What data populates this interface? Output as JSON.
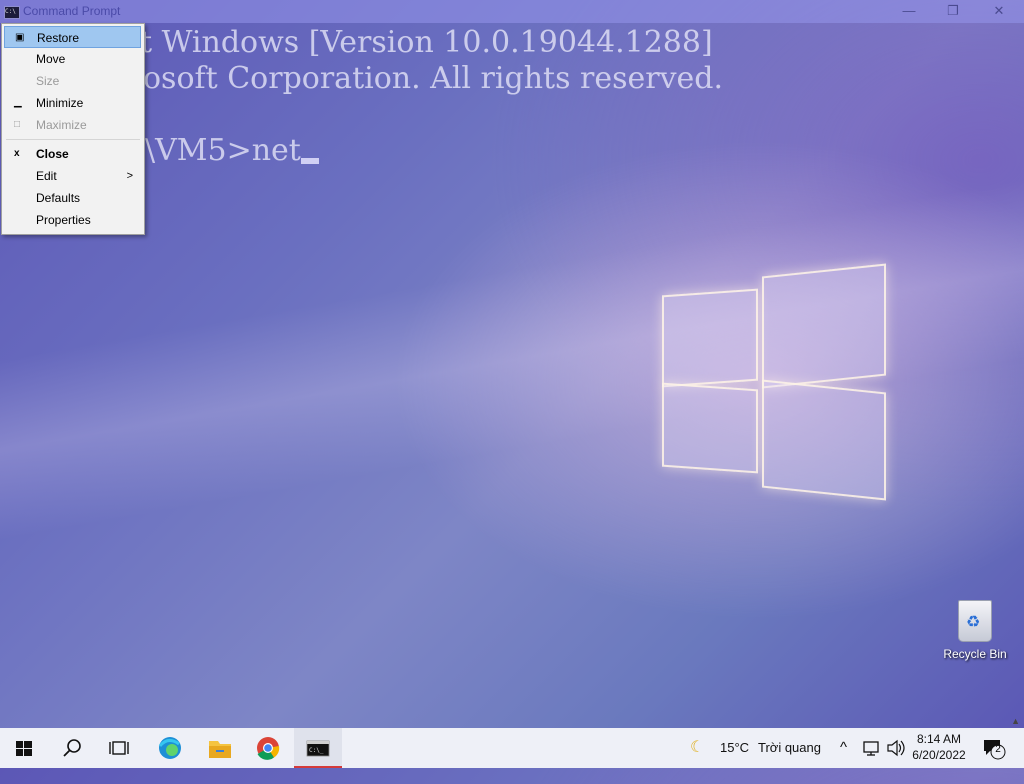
{
  "window": {
    "title": "Command Prompt",
    "icon": "console-app-icon",
    "minimize_glyph": "—",
    "maximize_glyph": "❐",
    "close_glyph": "✕"
  },
  "console": {
    "line1": "t Windows [Version 10.0.19044.1288]",
    "line2": "osoft Corporation. All rights reserved.",
    "line3": "\\VM5>net"
  },
  "system_menu": {
    "items": [
      {
        "label": "Restore",
        "glyph": "▣",
        "state": "highlighted"
      },
      {
        "label": "Move",
        "glyph": "",
        "state": "enabled"
      },
      {
        "label": "Size",
        "glyph": "",
        "state": "disabled"
      },
      {
        "label": "Minimize",
        "glyph": "▁",
        "state": "enabled"
      },
      {
        "label": "Maximize",
        "glyph": "□",
        "state": "disabled"
      },
      {
        "label": "Close",
        "glyph": "x",
        "state": "default-bold"
      },
      {
        "label": "Edit",
        "glyph": "",
        "state": "submenu",
        "arrow": ">"
      },
      {
        "label": "Defaults",
        "glyph": "",
        "state": "enabled"
      },
      {
        "label": "Properties",
        "glyph": "",
        "state": "enabled"
      }
    ]
  },
  "desktop": {
    "recycle_bin_label": "Recycle Bin"
  },
  "taskbar": {
    "apps": [
      "start-button",
      "search",
      "task-view",
      "edge",
      "file-explorer",
      "chrome",
      "command-prompt"
    ],
    "weather_temp": "15°C",
    "weather_text": "Trời quang",
    "tray_chevron": "^",
    "time": "8:14 AM",
    "date": "6/20/2022",
    "notification_count": "2"
  },
  "colors": {
    "menu_highlight": "#9fc7f0",
    "taskbar_active_underline": "#d43b3b"
  }
}
